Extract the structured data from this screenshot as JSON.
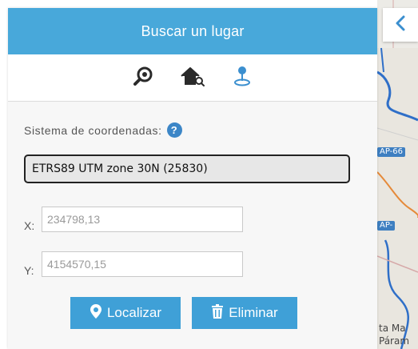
{
  "panel": {
    "title": "Buscar un lugar"
  },
  "tools": [
    {
      "icon": "search-location-icon"
    },
    {
      "icon": "house-search-icon"
    },
    {
      "icon": "map-pin-icon"
    }
  ],
  "coordinates": {
    "crs_label": "Sistema de coordenadas:",
    "crs_value": "ETRS89 UTM zone 30N (25830)",
    "x_label": "X:",
    "x_placeholder": "234798,13",
    "y_label": "Y:",
    "y_placeholder": "4154570,15"
  },
  "buttons": {
    "locate_label": "Localizar",
    "clear_label": "Eliminar"
  },
  "map": {
    "road_labels": [
      "AP-66",
      "AP-"
    ],
    "place_labels": [
      "ta Ma",
      "Páram"
    ]
  },
  "colors": {
    "header": "#48a8da",
    "button": "#3fa0d7",
    "accent": "#3b8fcf"
  }
}
